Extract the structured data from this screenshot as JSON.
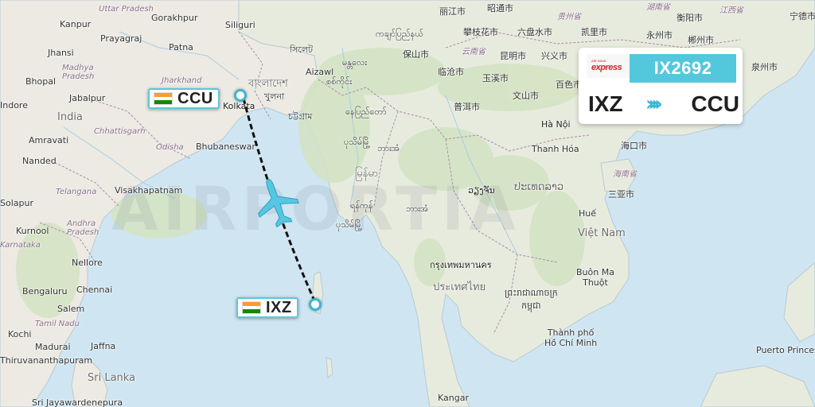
{
  "flight": {
    "number": "IX2692",
    "airline_logo_word": "express",
    "airline_logo_top": "AIR INDIA",
    "origin": "IXZ",
    "destination": "CCU",
    "arrow": "››››"
  },
  "airports": {
    "ccu_label": "CCU",
    "ixz_label": "IXZ"
  },
  "watermark": "AIRPORTIA",
  "labels": {
    "uttar_pradesh": "Uttar Pradesh",
    "kanpur": "Kanpur",
    "gorakhpur": "Gorakhpur",
    "siliguri": "Siliguri",
    "prayagraj": "Prayagraj",
    "patna": "Patna",
    "jhansi": "Jhansi",
    "madhya_pradesh": "Madhya\nPradesh",
    "bhopal": "Bhopal",
    "jabalpur": "Jabalpur",
    "jharkhand": "Jharkhand",
    "bangladesh": "বাংলাদেশ",
    "kolkata": "Kolkata",
    "khulna": "খুলনা",
    "chattogram": "চট্টগ্রাম",
    "india": "India",
    "indore": "Indore",
    "chhattisgarh": "Chhattisgarh",
    "odisha": "Odisha",
    "bhubaneswar": "Bhubaneswar",
    "amravati": "Amravati",
    "nanded": "Nanded",
    "telangana": "Telangana",
    "visakhapatnam": "Visakhapatnam",
    "solapur": "Solapur",
    "kurnool": "Kurnool",
    "andhra_pradesh": "Andhra\nPradesh",
    "karnataka": "Karnataka",
    "nellore": "Nellore",
    "bengaluru": "Bengaluru",
    "chennai": "Chennai",
    "salem": "Salem",
    "tamil_nadu": "Tamil Nadu",
    "kochi": "Kochi",
    "madurai": "Madurai",
    "jaffna": "Jaffna",
    "tvm": "Thiruvananthapuram",
    "sri_lanka": "Sri Lanka",
    "sri_j": "Sri Jayawardenepura",
    "aizawl": "Aizawl",
    "sylhet": "সিলেট",
    "myanmar": "မြန်မာ",
    "yangon": "ရန်ကုန်",
    "mandalay": "မန္တလေး",
    "naypyidaw": "နေပြည်တော်",
    "sagaing": "စစ်ကိုင်း",
    "bago": "ပုသိမ်မြို့",
    "kachin": "ကချင်ပြည်နယ်",
    "lijiang": "丽江市",
    "zhaotong": "昭通市",
    "guiyang": "贵州省",
    "hunan": "湖南省",
    "jiangxi": "江西省",
    "panzhihua": "攀枝花市",
    "liupanshui": "六盘水市",
    "kaili": "凯里市",
    "yongzhou": "永州市",
    "hengyang": "衡阳市",
    "ningde": "宁德市",
    "baoshan": "保山市",
    "yunnan": "云南省",
    "kunming": "昆明市",
    "xingyi": "兴义市",
    "chenzhou": "郴州市",
    "quanzhou": "泉州市",
    "lincang": "临沧市",
    "yuxi": "玉溪市",
    "baise": "百色市",
    "puer": "普洱市",
    "wenshan": "文山市",
    "hanoi": "Hà Nội",
    "thanhhoa": "Thanh Hóa",
    "haikou": "海口市",
    "hainan": "海南省",
    "sanya": "三亚市",
    "vientiane": "ວຽງຈັນ",
    "laos": "ປະເທດລາວ",
    "thailand_bkk": "กรุงเทพมหานคร",
    "thailand": "ประเทศไทย",
    "cambodia": "ព្រះរាជាណាចក្រ\nកម្ពុជា",
    "hue": "Huế",
    "vietnam": "Việt Nam",
    "buonmathuot": "Buôn Ma\nThuột",
    "hcmc": "Thành phố\nHồ Chí Minh",
    "puerto": "Puerto Princes",
    "kangar": "Kangar",
    "myingyan": "ဘားအံ"
  }
}
